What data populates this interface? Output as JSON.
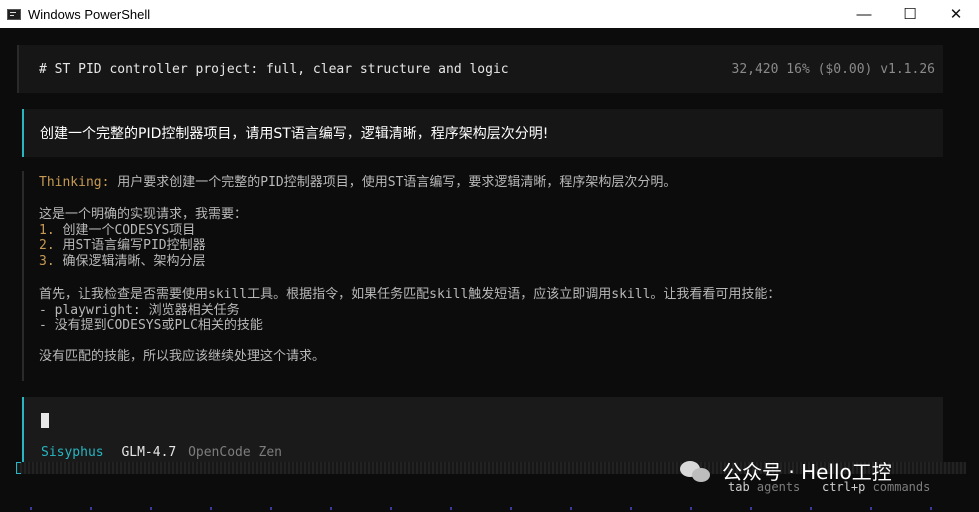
{
  "window": {
    "title": "Windows PowerShell",
    "minimize_glyph": "—",
    "maximize_glyph": "☐",
    "close_glyph": "✕"
  },
  "header": {
    "title": "# ST PID controller project: full, clear structure and logic",
    "meta": "32,420  16% ($0.00) v1.1.26"
  },
  "user_message": "创建一个完整的PID控制器项目，请用ST语言编写，逻辑清晰，程序架构层次分明!",
  "thinking": {
    "label": "Thinking:",
    "summary": " 用户要求创建一个完整的PID控制器项目，使用ST语言编写，要求逻辑清晰，程序架构层次分明。",
    "intro": "这是一个明确的实现请求，我需要：",
    "steps": [
      {
        "num": "1.",
        "text": " 创建一个CODESYS项目"
      },
      {
        "num": "2.",
        "text": " 用ST语言编写PID控制器"
      },
      {
        "num": "3.",
        "text": " 确保逻辑清晰、架构分层"
      }
    ],
    "check": "首先，让我检查是否需要使用skill工具。根据指令，如果任务匹配skill触发短语，应该立即调用skill。让我看看可用技能：",
    "skills": [
      "- playwright: 浏览器相关任务",
      "- 没有提到CODESYS或PLC相关的技能"
    ],
    "conclusion": "没有匹配的技能，所以我应该继续处理这个请求。"
  },
  "input": {
    "value": "",
    "agent": "Sisyphus",
    "model": "GLM-4.7",
    "provider": "OpenCode Zen"
  },
  "hints": {
    "tab_key": "tab",
    "tab_label": "agents",
    "ctrl_key": "ctrl+p",
    "ctrl_label": "commands"
  },
  "watermark": {
    "text": "公众号 · Hello工控"
  },
  "colors": {
    "accent": "#27b6c2",
    "thinking_label": "#c79a54",
    "background": "#0c0c0c"
  }
}
